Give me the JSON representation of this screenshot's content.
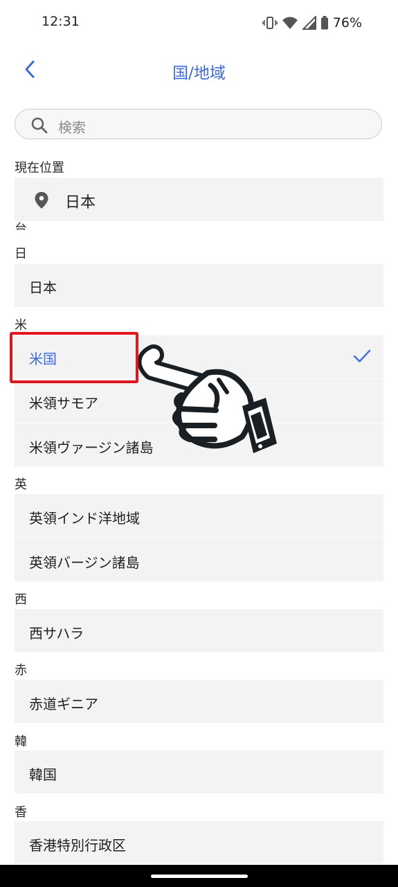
{
  "status_bar": {
    "time": "12:31",
    "battery": "76%"
  },
  "header": {
    "title": "国/地域"
  },
  "search": {
    "placeholder": "検索"
  },
  "current_location": {
    "label": "現在位置",
    "value": "日本"
  },
  "partial_heading": "台",
  "sections": [
    {
      "heading": "日",
      "items": [
        {
          "label": "日本"
        }
      ]
    },
    {
      "heading": "米",
      "items": [
        {
          "label": "米国",
          "selected": true
        },
        {
          "label": "米領サモア"
        },
        {
          "label": "米領ヴァージン諸島"
        }
      ]
    },
    {
      "heading": "英",
      "items": [
        {
          "label": "英領インド洋地域"
        },
        {
          "label": "英領バージン諸島"
        }
      ]
    },
    {
      "heading": "西",
      "items": [
        {
          "label": "西サハラ"
        }
      ]
    },
    {
      "heading": "赤",
      "items": [
        {
          "label": "赤道ギニア"
        }
      ]
    },
    {
      "heading": "韓",
      "items": [
        {
          "label": "韓国"
        }
      ]
    },
    {
      "heading": "香",
      "items": [
        {
          "label": "香港特別行政区"
        }
      ]
    }
  ],
  "colors": {
    "accent": "#3d6ae0",
    "highlight": "#e3161d",
    "row_bg": "#f3f3f3"
  },
  "icons": {
    "back": "chevron-left-icon",
    "search": "search-icon",
    "location": "location-pin-icon",
    "selected": "check-icon"
  }
}
